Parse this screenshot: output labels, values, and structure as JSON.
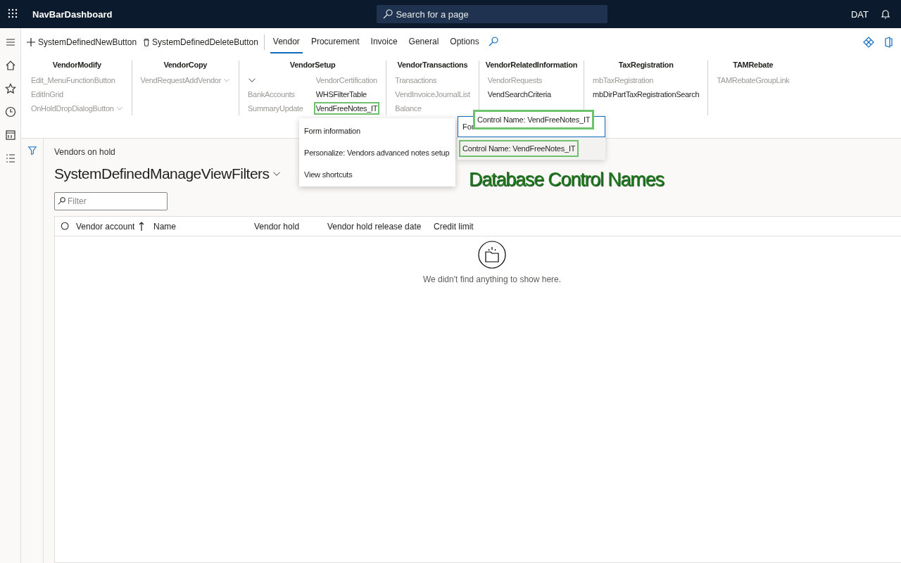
{
  "topbar": {
    "app_title": "NavBarDashboard",
    "search_placeholder": "Search for a page",
    "company": "DAT"
  },
  "actions": [
    {
      "label": "SystemDefinedNewButton",
      "kind": "new"
    },
    {
      "label": "SystemDefinedDeleteButton",
      "kind": "delete"
    }
  ],
  "tabs": [
    {
      "label": "Vendor",
      "selected": true
    },
    {
      "label": "Procurement",
      "selected": false
    },
    {
      "label": "Invoice",
      "selected": false
    },
    {
      "label": "General",
      "selected": false
    },
    {
      "label": "Options",
      "selected": false
    }
  ],
  "ribbon": [
    {
      "title": "VendorModify",
      "columns": [
        [
          {
            "label": "Edit_MenuFunctionButton",
            "disabled": true,
            "dropdown": false,
            "highlighted": false
          },
          {
            "label": "EditInGrid",
            "disabled": true,
            "dropdown": false,
            "highlighted": false
          },
          {
            "label": "OnHoldDropDialogButton",
            "disabled": true,
            "dropdown": true,
            "highlighted": false
          }
        ]
      ]
    },
    {
      "title": "VendorCopy",
      "columns": [
        [
          {
            "label": "VendRequestAddVendor",
            "disabled": true,
            "dropdown": true,
            "highlighted": false
          }
        ]
      ]
    },
    {
      "title": "VendorSetup",
      "columns": [
        [
          {
            "kind": "chevron",
            "disabled": false,
            "highlighted": false
          },
          {
            "label": "BankAccounts",
            "disabled": true,
            "dropdown": false,
            "highlighted": false
          },
          {
            "label": "SummaryUpdate",
            "disabled": true,
            "dropdown": false,
            "highlighted": false
          }
        ],
        [
          {
            "label": "VendorCertification",
            "disabled": true,
            "dropdown": false,
            "highlighted": false
          },
          {
            "label": "WHSFilterTable",
            "disabled": false,
            "dropdown": false,
            "highlighted": false
          },
          {
            "label": "VendFreeNotes_IT",
            "disabled": false,
            "dropdown": false,
            "highlighted": true
          }
        ]
      ]
    },
    {
      "title": "VendorTransactions",
      "columns": [
        [
          {
            "label": "Transactions",
            "disabled": true,
            "dropdown": false,
            "highlighted": false
          },
          {
            "label": "VendInvoiceJournalList",
            "disabled": true,
            "dropdown": false,
            "highlighted": false
          },
          {
            "label": "Balance",
            "disabled": true,
            "dropdown": false,
            "highlighted": false
          }
        ]
      ]
    },
    {
      "title": "VendorRelatedInformation",
      "columns": [
        [
          {
            "label": "VendorRequests",
            "disabled": true,
            "dropdown": false,
            "highlighted": false
          },
          {
            "label": "VendSearchCriteria",
            "disabled": false,
            "dropdown": false,
            "highlighted": false
          }
        ]
      ]
    },
    {
      "title": "TaxRegistration",
      "columns": [
        [
          {
            "label": "mbTaxRegistration",
            "disabled": true,
            "dropdown": false,
            "highlighted": false
          },
          {
            "label": "mbDirPartTaxRegistrationSearch",
            "disabled": false,
            "dropdown": false,
            "highlighted": false
          }
        ]
      ]
    },
    {
      "title": "TAMRebate",
      "columns": [
        [
          {
            "label": "TAMRebateGroupLink",
            "disabled": true,
            "dropdown": false,
            "highlighted": false
          }
        ]
      ]
    }
  ],
  "context_menu": [
    "Form information",
    "Personalize: Vendors advanced notes setup",
    "View shortcuts"
  ],
  "form_info": {
    "field_value": "For",
    "field_callout": "Control Name: VendFreeNotes_IT",
    "option": "Control Name: VendFreeNotes_IT"
  },
  "annotation": "Database Control Names",
  "page": {
    "caption": "Vendors on hold",
    "title": "SystemDefinedManageViewFilters",
    "filter_placeholder": "Filter"
  },
  "table": {
    "columns": [
      "Vendor account",
      "Name",
      "Vendor hold",
      "Vendor hold release date",
      "Credit limit"
    ],
    "empty_message": "We didn't find anything to show here."
  }
}
